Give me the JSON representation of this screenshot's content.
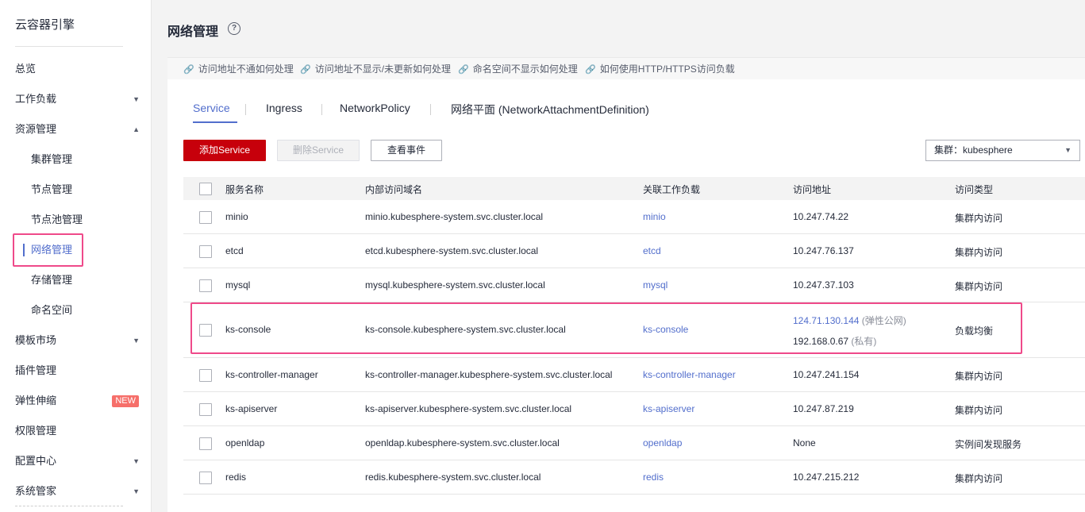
{
  "app_title": "云容器引擎",
  "sidebar": {
    "items": [
      {
        "label": "总览"
      },
      {
        "label": "工作负载"
      },
      {
        "label": "资源管理"
      },
      {
        "label": "集群管理"
      },
      {
        "label": "节点管理"
      },
      {
        "label": "节点池管理"
      },
      {
        "label": "网络管理"
      },
      {
        "label": "存储管理"
      },
      {
        "label": "命名空间"
      },
      {
        "label": "模板市场"
      },
      {
        "label": "插件管理"
      },
      {
        "label": "弹性伸缩",
        "badge": "NEW"
      },
      {
        "label": "权限管理"
      },
      {
        "label": "配置中心"
      },
      {
        "label": "系统管家"
      }
    ]
  },
  "page": {
    "title": "网络管理",
    "help_icon": "?"
  },
  "faq_links": [
    "访问地址不通如何处理",
    "访问地址不显示/未更新如何处理",
    "命名空间不显示如何处理",
    "如何使用HTTP/HTTPS访问负载"
  ],
  "tabs": [
    "Service",
    "Ingress",
    "NetworkPolicy",
    "网络平面 (NetworkAttachmentDefinition)"
  ],
  "toolbar": {
    "add_label": "添加Service",
    "delete_label": "删除Service",
    "events_label": "查看事件",
    "cluster_select": "集群：kubesphere"
  },
  "table": {
    "headers": [
      "服务名称",
      "内部访问域名",
      "关联工作负载",
      "访问地址",
      "访问类型"
    ],
    "rows": [
      {
        "name": "minio",
        "domain": "minio.kubesphere-system.svc.cluster.local",
        "workload": "minio",
        "address": "10.247.74.22",
        "type": "集群内访问"
      },
      {
        "name": "etcd",
        "domain": "etcd.kubesphere-system.svc.cluster.local",
        "workload": "etcd",
        "address": "10.247.76.137",
        "type": "集群内访问"
      },
      {
        "name": "mysql",
        "domain": "mysql.kubesphere-system.svc.cluster.local",
        "workload": "mysql",
        "address": "10.247.37.103",
        "type": "集群内访问"
      },
      {
        "name": "ks-console",
        "domain": "ks-console.kubesphere-system.svc.cluster.local",
        "workload": "ks-console",
        "address": "124.71.130.144",
        "address_note": "(弹性公网)",
        "address2": "192.168.0.67",
        "address2_note": "(私有)",
        "type": "负载均衡"
      },
      {
        "name": "ks-controller-manager",
        "domain": "ks-controller-manager.kubesphere-system.svc.cluster.local",
        "workload": "ks-controller-manager",
        "address": "10.247.241.154",
        "type": "集群内访问"
      },
      {
        "name": "ks-apiserver",
        "domain": "ks-apiserver.kubesphere-system.svc.cluster.local",
        "workload": "ks-apiserver",
        "address": "10.247.87.219",
        "type": "集群内访问"
      },
      {
        "name": "openldap",
        "domain": "openldap.kubesphere-system.svc.cluster.local",
        "workload": "openldap",
        "address": "None",
        "type": "实例间发现服务"
      },
      {
        "name": "redis",
        "domain": "redis.kubesphere-system.svc.cluster.local",
        "workload": "redis",
        "address": "10.247.215.212",
        "type": "集群内访问"
      }
    ]
  },
  "colors": {
    "accent": "#526ecc",
    "primary_button": "#c7000b",
    "highlight_box": "#ef4a8a",
    "badge": "#f66f6a"
  }
}
